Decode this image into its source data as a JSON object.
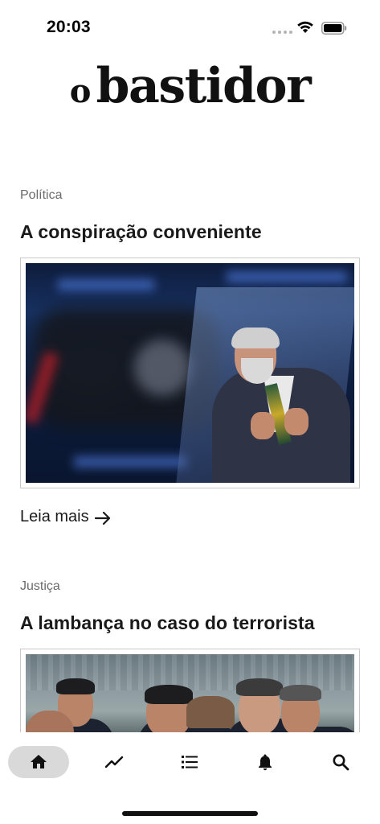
{
  "status_bar": {
    "time": "20:03"
  },
  "header": {
    "logo_small": "o",
    "logo_big": "bastidor"
  },
  "articles": [
    {
      "category": "Política",
      "headline": "A conspiração conveniente",
      "read_more": "Leia mais"
    },
    {
      "category": "Justiça",
      "headline": "A lambança no caso do terrorista"
    }
  ],
  "bottom_nav": {
    "items": [
      {
        "icon": "home-icon",
        "active": true
      },
      {
        "icon": "trending-icon",
        "active": false
      },
      {
        "icon": "list-icon",
        "active": false
      },
      {
        "icon": "bell-icon",
        "active": false
      },
      {
        "icon": "search-icon",
        "active": false
      }
    ]
  },
  "colors": {
    "text": "#1a1a1a",
    "category": "#6b6b6b",
    "active_nav_bg": "#d9d9d9",
    "border": "#c9c9c9"
  }
}
